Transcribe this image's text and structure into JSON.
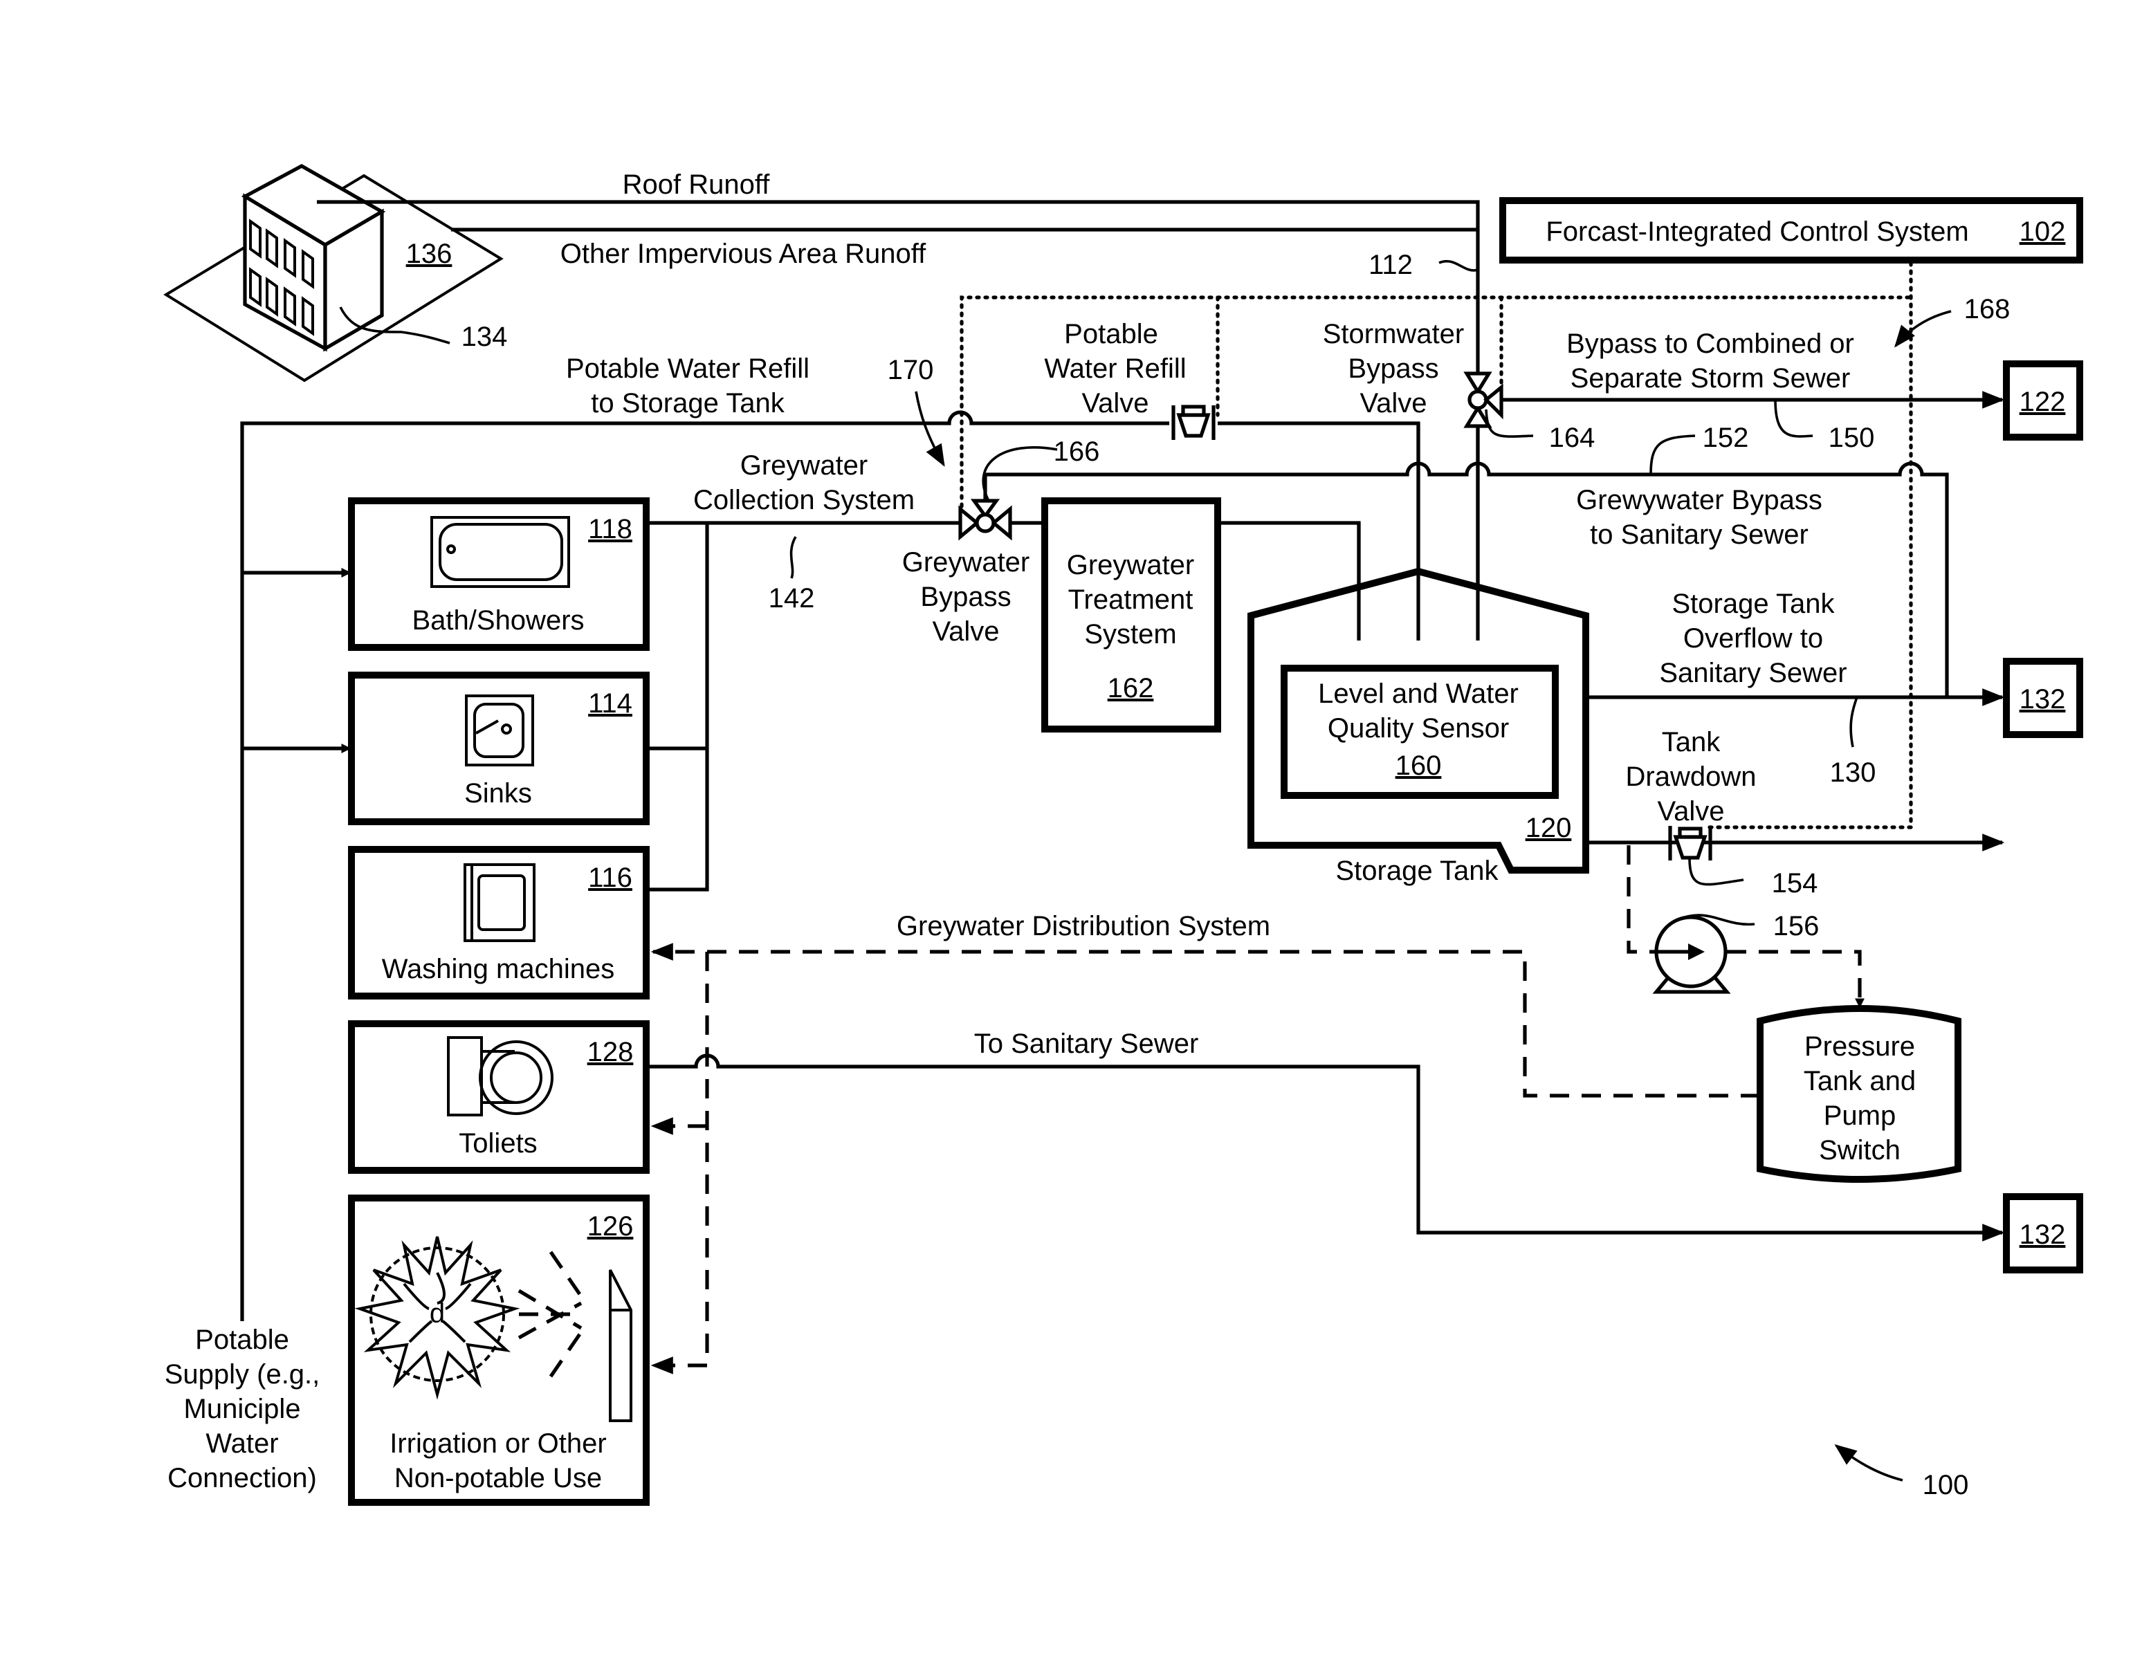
{
  "figure": {
    "number": "100",
    "colors": {
      "line": "#000000",
      "background": "#ffffff"
    }
  },
  "building": {
    "ref_site": "136",
    "ref_building": "134",
    "roof_runoff_label": "Roof Runoff",
    "impervious_runoff_label": "Other Impervious Area Runoff",
    "runoff_conduit_ref": "112"
  },
  "control_system": {
    "label": "Forcast-Integrated Control System",
    "ref": "102",
    "signal_ref": "168",
    "signal_ref_left": "170"
  },
  "potable": {
    "refill_line_label_1": "Potable Water Refill",
    "refill_line_label_2": "to Storage Tank",
    "refill_valve_label": [
      "Potable",
      "Water Refill",
      "Valve"
    ],
    "supply_label": [
      "Potable",
      "Supply (e.g.,",
      "Municiple",
      "Water",
      "Connection)"
    ]
  },
  "stormwater": {
    "valve_label": [
      "Stormwater",
      "Bypass",
      "Valve"
    ],
    "valve_ref": "164",
    "bypass_label": [
      "Bypass to Combined or",
      "Separate Storm Sewer"
    ],
    "bypass_line_ref": "150",
    "destination_ref": "122"
  },
  "greywater": {
    "collection_label": [
      "Greywater",
      "Collection System"
    ],
    "collection_ref": "142",
    "bypass_valve_label": [
      "Greywater",
      "Bypass",
      "Valve"
    ],
    "bypass_valve_ref": "166",
    "bypass_line_ref": "152",
    "bypass_to_sewer_label": [
      "Grewywater Bypass",
      "to Sanitary Sewer"
    ],
    "treatment_label": [
      "Greywater",
      "Treatment",
      "System"
    ],
    "treatment_ref": "162",
    "distribution_label": "Greywater Distribution System"
  },
  "storage_tank": {
    "label": "Storage Tank",
    "ref": "120",
    "sensor_label": [
      "Level and Water",
      "Quality Sensor"
    ],
    "sensor_ref": "160",
    "overflow_label": [
      "Storage Tank",
      "Overflow to",
      "Sanitary Sewer"
    ],
    "overflow_ref": "130",
    "overflow_destination_ref": "132",
    "drawdown_valve_label": [
      "Tank",
      "Drawdown",
      "Valve"
    ],
    "drawdown_valve_ref": "154",
    "pump_ref": "156"
  },
  "pressure_tank": {
    "label": [
      "Pressure",
      "Tank and",
      "Pump",
      "Switch"
    ]
  },
  "fixtures": [
    {
      "name": "Bath/Showers",
      "ref": "118",
      "icon": "bathtub-icon"
    },
    {
      "name": "Sinks",
      "ref": "114",
      "icon": "sink-icon"
    },
    {
      "name": "Washing machines",
      "ref": "116",
      "icon": "washing-machine-icon"
    },
    {
      "name": "Toliets",
      "ref": "128",
      "icon": "toilet-icon"
    },
    {
      "name_1": "Irrigation or Other",
      "name_2": "Non-potable Use",
      "ref": "126",
      "icon": "irrigation-icon"
    }
  ],
  "sanitary": {
    "label": "To Sanitary Sewer",
    "destination_ref": "132"
  }
}
